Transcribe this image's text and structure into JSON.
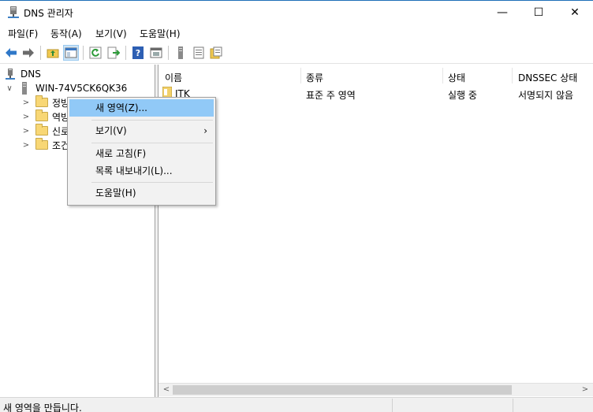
{
  "window": {
    "title": "DNS 관리자",
    "minimize": "—",
    "maximize": "☐",
    "close": "✕"
  },
  "menu": [
    "파일(F)",
    "동작(A)",
    "보기(V)",
    "도움말(H)"
  ],
  "toolbar": {
    "icons": [
      "back-arrow-icon",
      "forward-arrow-icon",
      "up-folder-icon",
      "show-hide-tree-icon",
      "refresh-icon",
      "export-list-icon",
      "help-icon",
      "console-icon",
      "server-icon",
      "list-icon",
      "properties-icon"
    ]
  },
  "tree": {
    "root": "DNS",
    "server": "WIN-74V5CK6QK36",
    "folders": [
      "정방",
      "역방",
      "신로",
      "조건"
    ]
  },
  "list": {
    "columns": [
      "이름",
      "종류",
      "상태",
      "DNSSEC 상태"
    ],
    "rows": [
      {
        "name": "JTK",
        "type": "표준 주 영역",
        "status": "실행 중",
        "dnssec": "서명되지 않음"
      }
    ]
  },
  "context_menu": {
    "items": [
      {
        "label": "새 영역(Z)...",
        "highlighted": true
      },
      {
        "label": "보기(V)",
        "submenu": true
      },
      {
        "label": "새로 고침(F)"
      },
      {
        "label": "목록 내보내기(L)..."
      },
      {
        "label": "도움말(H)"
      }
    ],
    "submenu_arrow": "›"
  },
  "scrollbar": {
    "left_arrow": "<",
    "right_arrow": ">"
  },
  "status": {
    "text": "새 영역을 만듭니다."
  }
}
